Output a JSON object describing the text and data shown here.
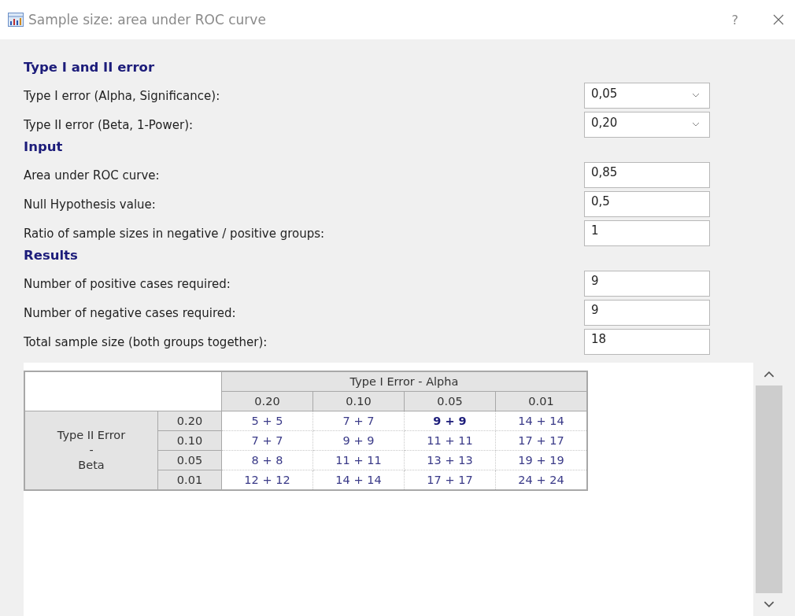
{
  "window": {
    "title": "Sample size: area under ROC curve",
    "help": "?"
  },
  "sections": [
    {
      "heading": "Type I and II error",
      "rows": [
        {
          "kind": "dropdown",
          "label": "Type I error (Alpha, Significance):",
          "value": "0,05"
        },
        {
          "kind": "dropdown",
          "label": "Type II error (Beta, 1-Power):",
          "value": "0,20"
        }
      ]
    },
    {
      "heading": "Input",
      "rows": [
        {
          "kind": "input",
          "label": "Area under ROC curve:",
          "value": "0,85"
        },
        {
          "kind": "input",
          "label": "Null Hypothesis value:",
          "value": "0,5"
        },
        {
          "kind": "input",
          "label": "Ratio of sample sizes in negative / positive groups:",
          "value": "1"
        }
      ]
    },
    {
      "heading": "Results",
      "rows": [
        {
          "kind": "input",
          "label": "Number of positive cases required:",
          "value": "9"
        },
        {
          "kind": "input",
          "label": "Number of negative cases required:",
          "value": "9"
        },
        {
          "kind": "input",
          "label": "Total sample size (both groups together):",
          "value": "18"
        }
      ]
    }
  ],
  "table": {
    "column_group": "Type I Error - Alpha",
    "row_group": [
      "Type II Error",
      "-",
      "Beta"
    ],
    "columns": [
      "0.20",
      "0.10",
      "0.05",
      "0.01"
    ],
    "rows": [
      {
        "beta": "0.20",
        "cells": [
          {
            "text": "5 + 5",
            "highlighted": false
          },
          {
            "text": "7 + 7",
            "highlighted": false
          },
          {
            "text": "9 + 9",
            "highlighted": true
          },
          {
            "text": "14 + 14",
            "highlighted": false
          }
        ]
      },
      {
        "beta": "0.10",
        "cells": [
          {
            "text": "7 + 7",
            "highlighted": false
          },
          {
            "text": "9 + 9",
            "highlighted": false
          },
          {
            "text": "11 + 11",
            "highlighted": false
          },
          {
            "text": "17 + 17",
            "highlighted": false
          }
        ]
      },
      {
        "beta": "0.05",
        "cells": [
          {
            "text": "8 + 8",
            "highlighted": false
          },
          {
            "text": "11 + 11",
            "highlighted": false
          },
          {
            "text": "13 + 13",
            "highlighted": false
          },
          {
            "text": "19 + 19",
            "highlighted": false
          }
        ]
      },
      {
        "beta": "0.01",
        "cells": [
          {
            "text": "12 + 12",
            "highlighted": false
          },
          {
            "text": "14 + 14",
            "highlighted": false
          },
          {
            "text": "17 + 17",
            "highlighted": false
          },
          {
            "text": "24 + 24",
            "highlighted": false
          }
        ]
      }
    ]
  }
}
